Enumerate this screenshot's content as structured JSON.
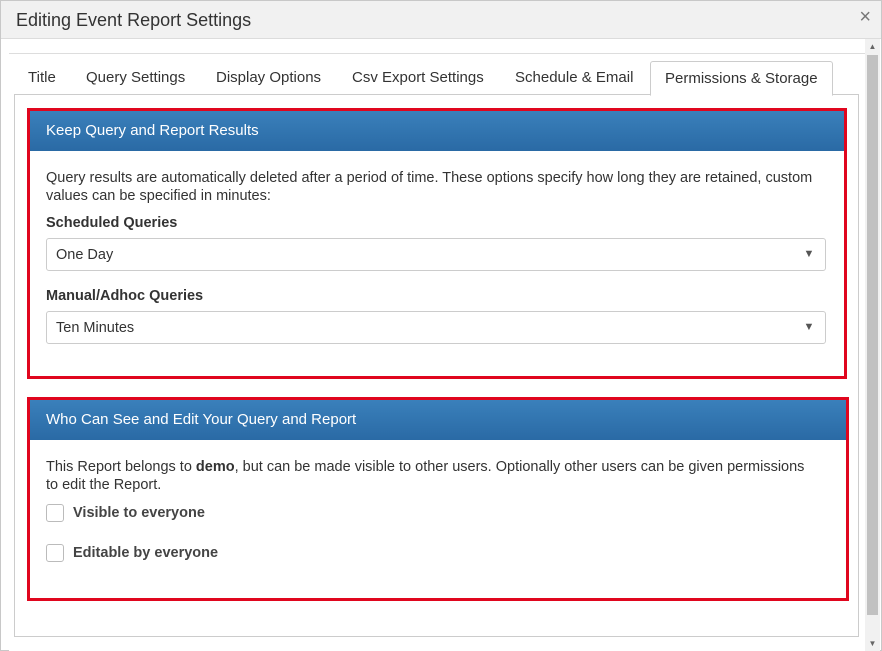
{
  "dialog": {
    "title": "Editing Event Report Settings",
    "close_glyph": "×"
  },
  "tabs": [
    {
      "label": "Title"
    },
    {
      "label": "Query Settings"
    },
    {
      "label": "Display Options"
    },
    {
      "label": "Csv Export Settings"
    },
    {
      "label": "Schedule & Email"
    },
    {
      "label": "Permissions & Storage",
      "active": true
    }
  ],
  "storage": {
    "heading": "Keep Query and Report Results",
    "description": "Query results are automatically deleted after a period of time. These options specify how long they are retained, custom values can be specified in minutes:",
    "scheduled_label": "Scheduled Queries",
    "scheduled_value": "One Day",
    "manual_label": "Manual/Adhoc Queries",
    "manual_value": "Ten Minutes"
  },
  "permissions": {
    "heading": "Who Can See and Edit Your Query and Report",
    "desc_before": "This Report belongs to ",
    "owner": "demo",
    "desc_after": ", but can be made visible to other users. Optionally other users can be given permissions to edit the Report.",
    "visible_label": "Visible to everyone",
    "visible_checked": false,
    "editable_label": "Editable by everyone",
    "editable_checked": false
  },
  "icons": {
    "caret": "▼",
    "scroll_up": "▲",
    "scroll_down": "▼"
  },
  "colors": {
    "header_blue": "#2e72ad",
    "highlight_red": "#e0061e"
  }
}
